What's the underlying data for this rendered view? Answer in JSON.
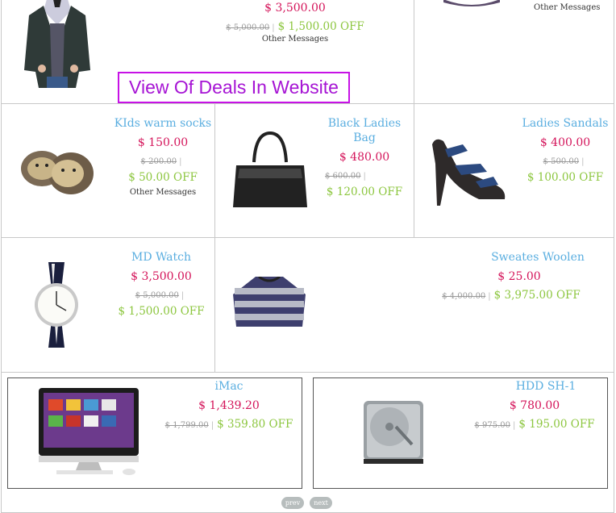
{
  "banner": {
    "text": "View Of Deals In Website"
  },
  "products": {
    "top_left": {
      "price": "$ 3,500.00",
      "old_price": "$ 5,000.00",
      "off": "$ 1,500.00 OFF",
      "message": "Other Messages"
    },
    "top_right": {
      "message": "Other Messages"
    },
    "socks": {
      "name": "KIds warm socks",
      "price": "$ 150.00",
      "old_price": "$ 200.00",
      "off": "$ 50.00 OFF",
      "message": "Other Messages"
    },
    "bag": {
      "name_line1": "Black Ladies",
      "name_line2": "Bag",
      "price": "$ 480.00",
      "old_price": "$ 600.00",
      "off": "$ 120.00 OFF"
    },
    "sandals": {
      "name": "Ladies Sandals",
      "price": "$ 400.00",
      "old_price": "$ 500.00",
      "off": "$ 100.00 OFF"
    },
    "watch": {
      "name": "MD Watch",
      "price": "$ 3,500.00",
      "old_price": "$ 5,000.00",
      "off": "$ 1,500.00 OFF"
    },
    "sweater": {
      "name": "Sweates Woolen",
      "price": "$ 25.00",
      "old_price": "$ 4,000.00",
      "off": "$ 3,975.00 OFF"
    },
    "imac": {
      "name": "iMac",
      "price": "$ 1,439.20",
      "old_price": "$ 1,799.00",
      "off": "$ 359.80 OFF"
    },
    "hdd": {
      "name": "HDD SH-1",
      "price": "$ 780.00",
      "old_price": "$ 975.00",
      "off": "$ 195.00 OFF"
    }
  },
  "pager": {
    "prev": "prev",
    "next": "next"
  },
  "colors": {
    "name": "#5aaee0",
    "price": "#d4145a",
    "off": "#8cc63e",
    "banner": "#c712e6"
  },
  "icons": [
    "blazer-image",
    "shoe-image",
    "socks-image",
    "handbag-image",
    "sandal-image",
    "watch-image",
    "sweater-image",
    "imac-image",
    "hdd-image"
  ]
}
